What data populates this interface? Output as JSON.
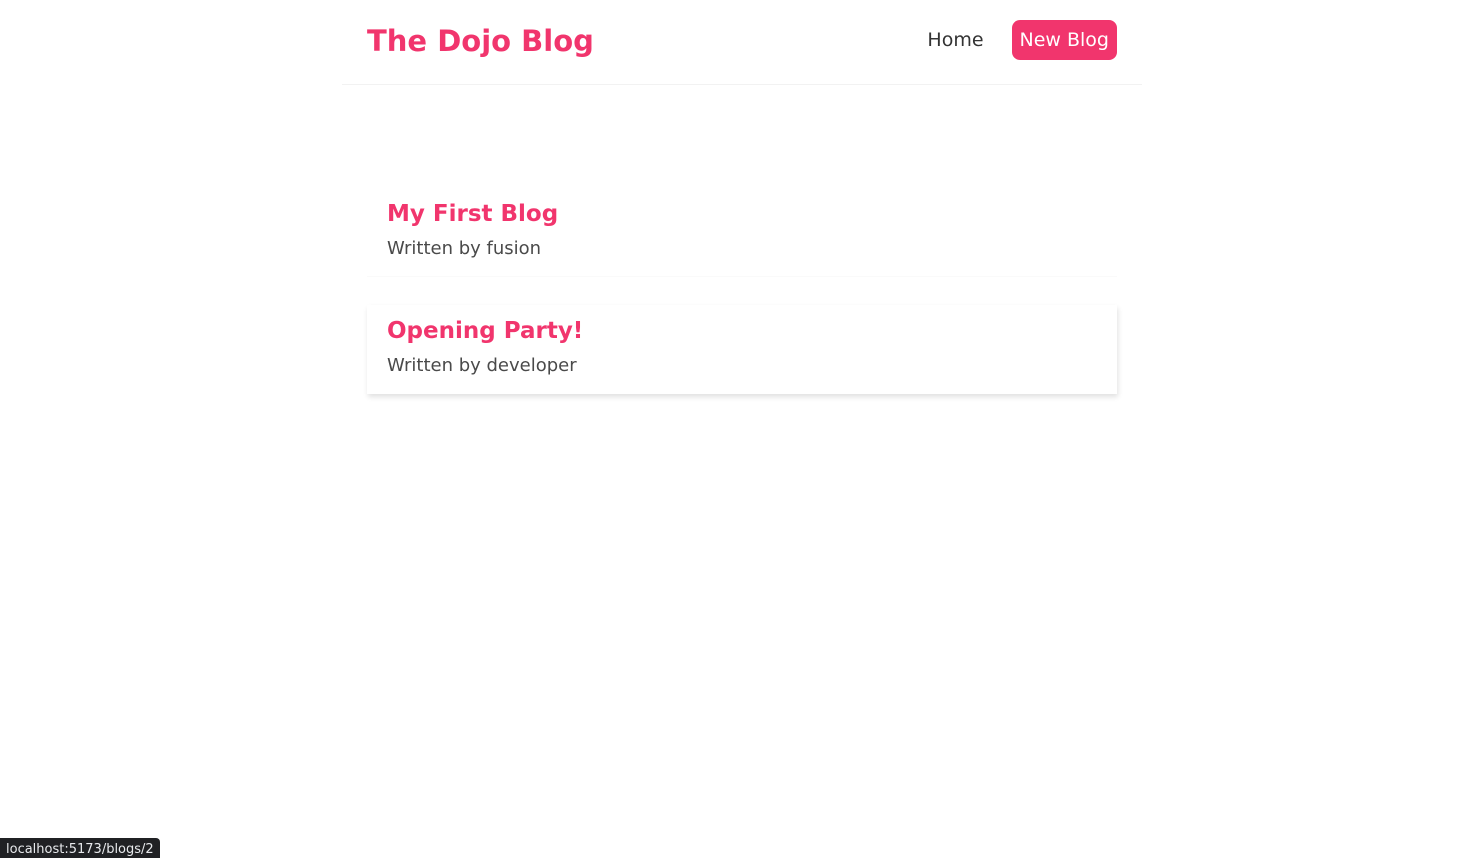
{
  "navbar": {
    "brand": "The Dojo Blog",
    "links": [
      {
        "label": "Home"
      },
      {
        "label": "New Blog"
      }
    ]
  },
  "blogs": [
    {
      "title": "My First Blog",
      "author_line": "Written by fusion"
    },
    {
      "title": "Opening Party!",
      "author_line": "Written by developer"
    }
  ],
  "status_bar": {
    "url": "localhost:5173/blogs/2"
  },
  "colors": {
    "accent": "#f1356d",
    "text": "#333333",
    "status_bg": "#202124"
  }
}
